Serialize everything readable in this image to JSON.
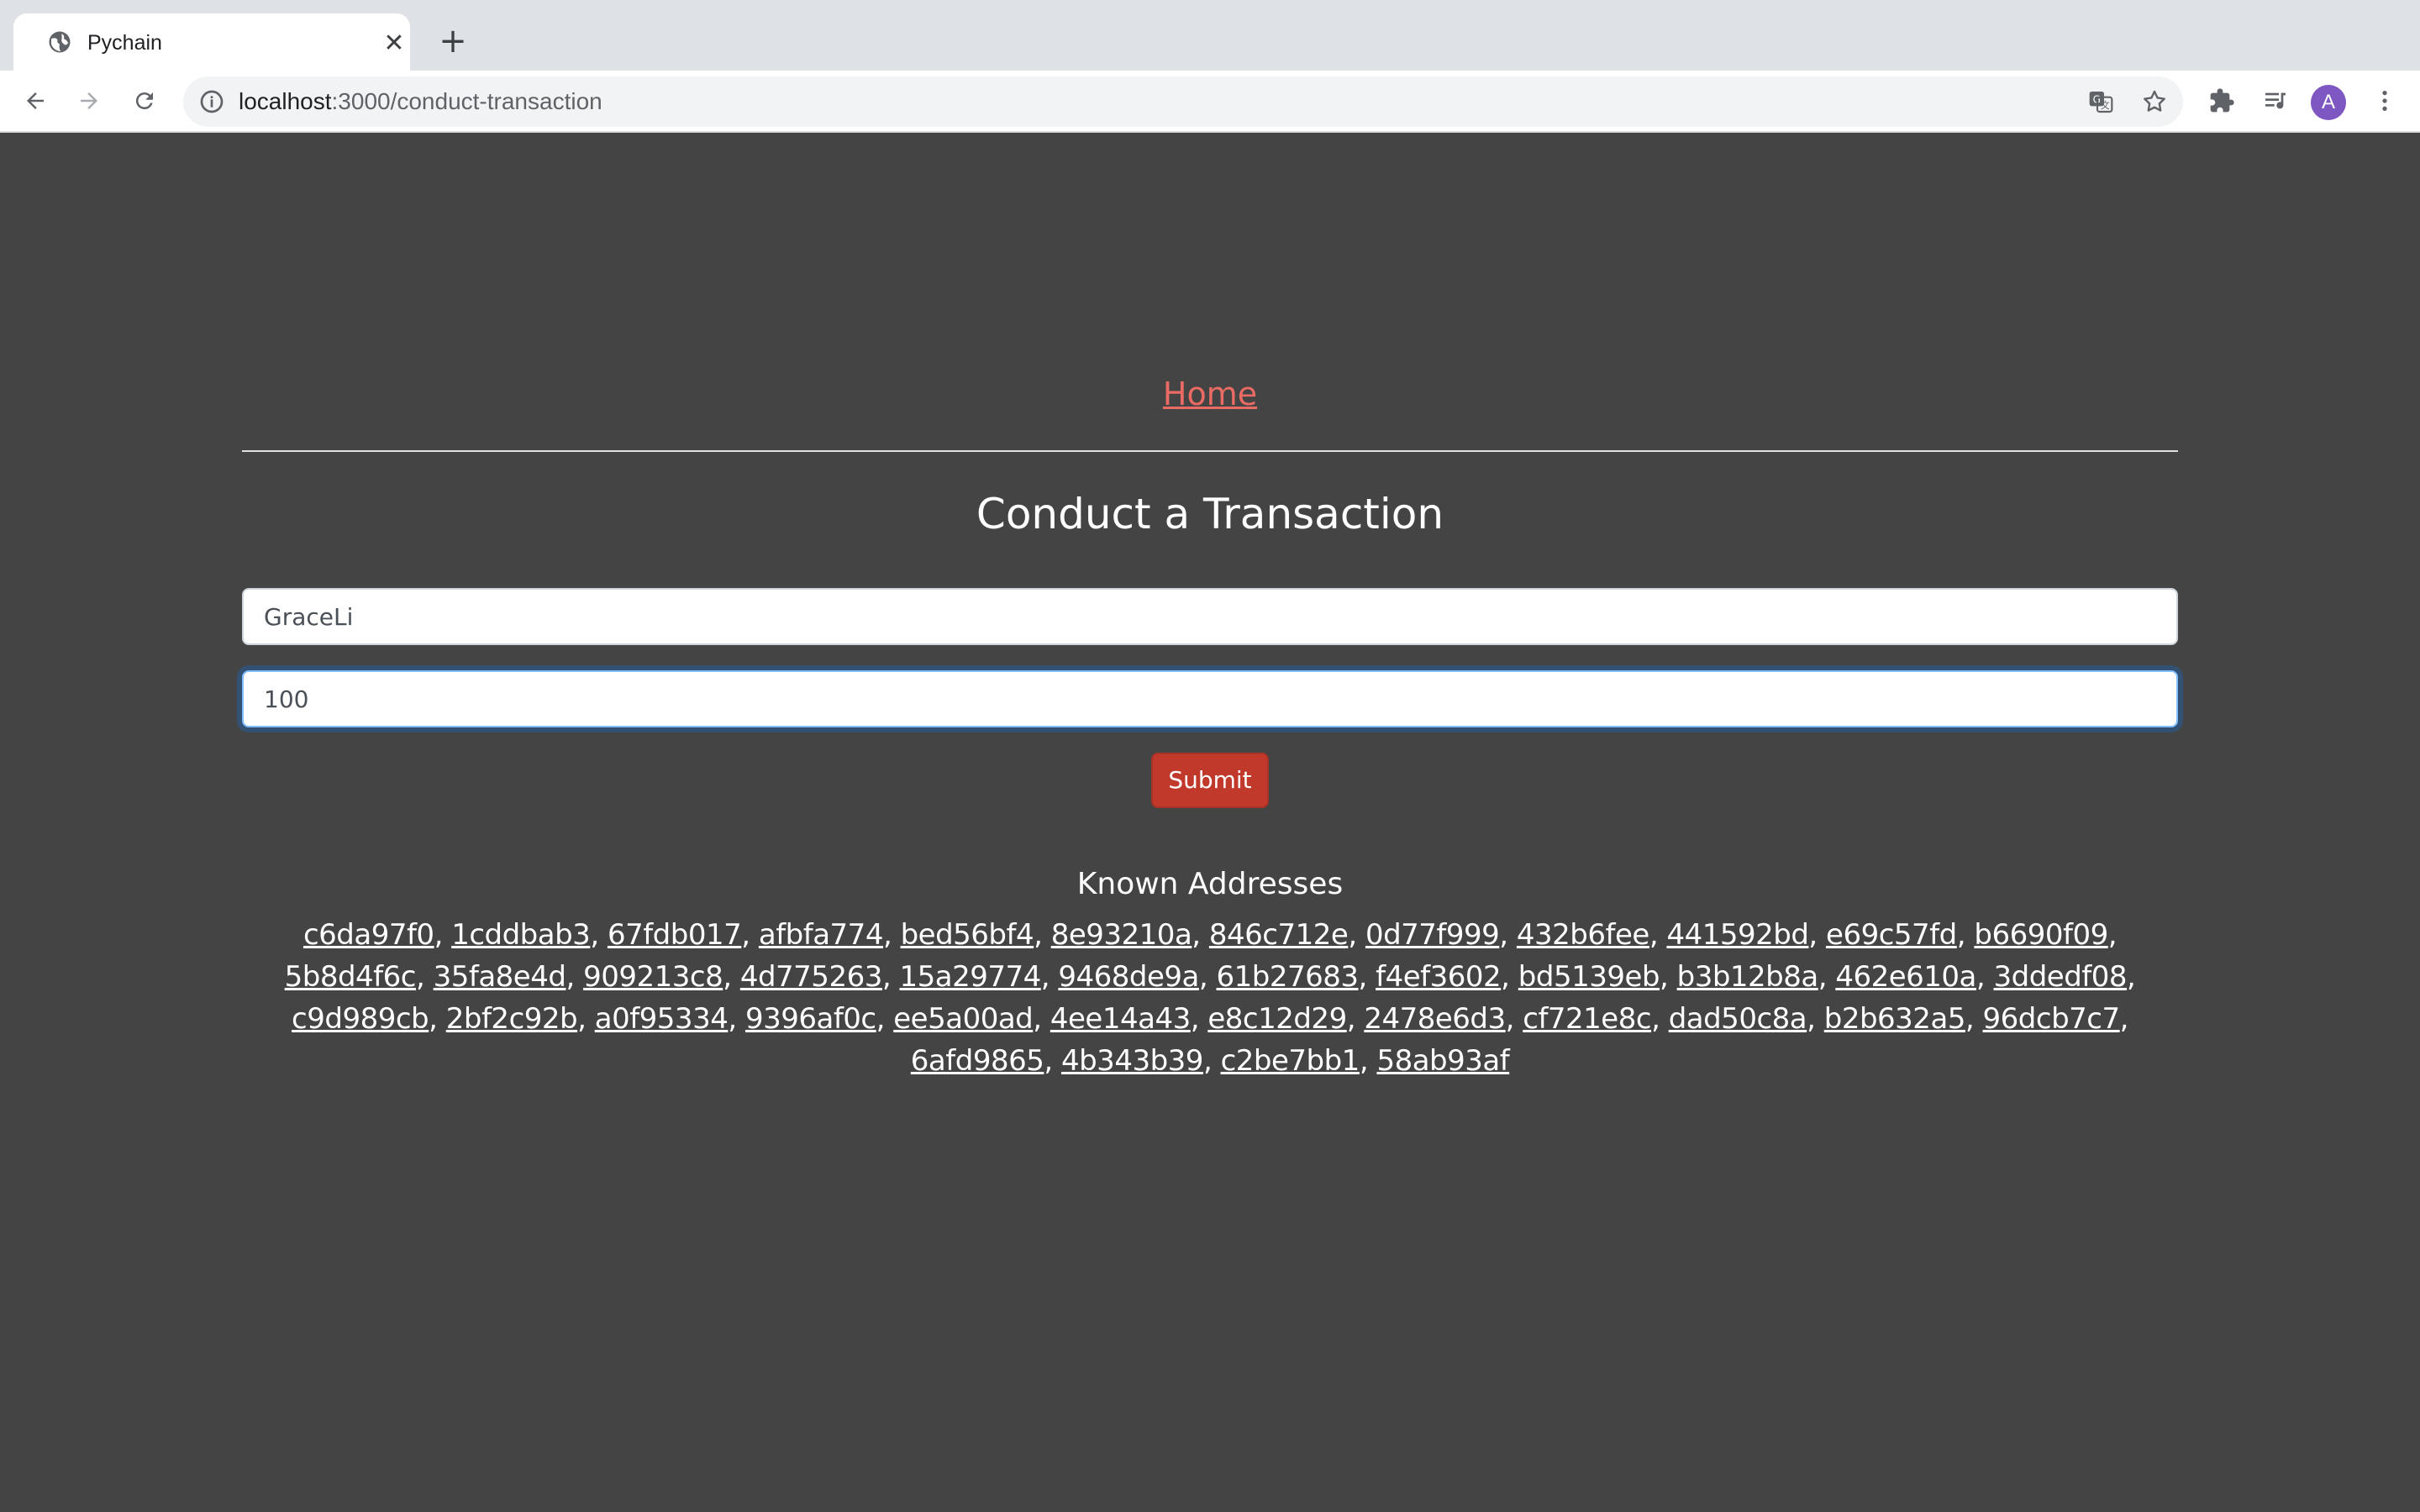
{
  "browser": {
    "tab": {
      "title": "Pychain",
      "favicon": "globe-icon",
      "close_glyph": "✕"
    },
    "new_tab_glyph": "+",
    "url": {
      "host": "localhost",
      "path": ":3000/conduct-transaction"
    },
    "profile_initial": "A",
    "profile_color": "#7e57c2"
  },
  "nav": {
    "home_label": "Home"
  },
  "page": {
    "title": "Conduct a Transaction"
  },
  "form": {
    "recipient_value": "GraceLi",
    "amount_value": "100",
    "submit_label": "Submit"
  },
  "known_addresses": {
    "title": "Known Addresses",
    "items": [
      "c6da97f0",
      "1cddbab3",
      "67fdb017",
      "afbfa774",
      "bed56bf4",
      "8e93210a",
      "846c712e",
      "0d77f999",
      "432b6fee",
      "441592bd",
      "e69c57fd",
      "b6690f09",
      "5b8d4f6c",
      "35fa8e4d",
      "909213c8",
      "4d775263",
      "15a29774",
      "9468de9a",
      "61b27683",
      "f4ef3602",
      "bd5139eb",
      "b3b12b8a",
      "462e610a",
      "3ddedf08",
      "c9d989cb",
      "2bf2c92b",
      "a0f95334",
      "9396af0c",
      "ee5a00ad",
      "4ee14a43",
      "e8c12d29",
      "2478e6d3",
      "cf721e8c",
      "dad50c8a",
      "b2b632a5",
      "96dcb7c7",
      "6afd9865",
      "4b343b39",
      "c2be7bb1",
      "58ab93af"
    ]
  },
  "colors": {
    "page_background": "#444444",
    "home_link": "#e96b63",
    "submit_button": "#c0392b",
    "focus_ring": "#80bdff"
  }
}
